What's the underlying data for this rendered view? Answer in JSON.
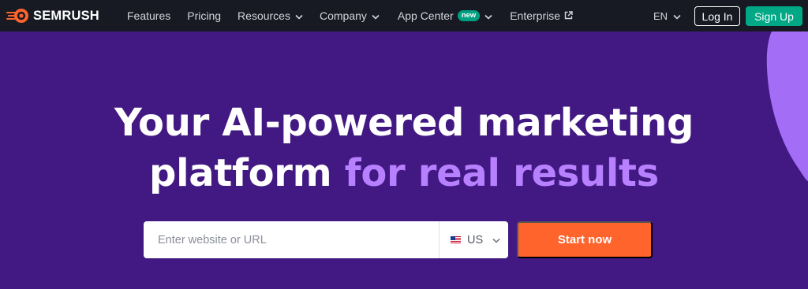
{
  "brand": {
    "name": "SEMRUSH",
    "logo_icon": "semrush-flame-icon",
    "accent_color": "#ff642d"
  },
  "nav": {
    "items": [
      {
        "label": "Features",
        "has_dropdown": false
      },
      {
        "label": "Pricing",
        "has_dropdown": false
      },
      {
        "label": "Resources",
        "has_dropdown": true
      },
      {
        "label": "Company",
        "has_dropdown": true
      },
      {
        "label": "App Center",
        "has_dropdown": true,
        "badge": "new"
      },
      {
        "label": "Enterprise",
        "has_dropdown": false,
        "external": true
      }
    ],
    "language": "EN",
    "login_label": "Log In",
    "signup_label": "Sign Up",
    "signup_color": "#00a886"
  },
  "hero": {
    "title_line1": "Your AI-powered marketing",
    "title_line2_plain": "platform ",
    "title_line2_accent": "for real results",
    "accent_color": "#b780ff",
    "background_color": "#421983"
  },
  "search": {
    "placeholder": "Enter website or URL",
    "value": "",
    "country": "US",
    "country_flag_icon": "us-flag-icon"
  },
  "cta": {
    "start_label": "Start now",
    "color": "#ff642d"
  }
}
